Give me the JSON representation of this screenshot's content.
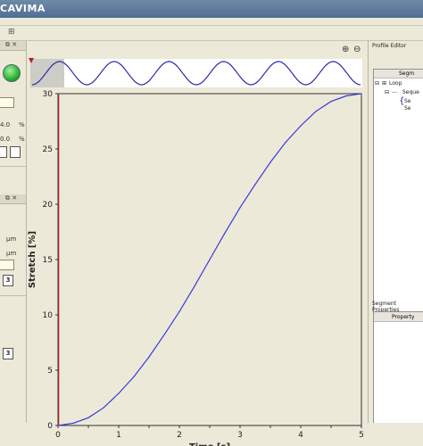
{
  "app": {
    "title": "CAVIMA"
  },
  "left_panel": {
    "close_glyph": "⧉ ✕",
    "values": {
      "v1": "4.0",
      "v1_unit": "%",
      "v2": "0.0",
      "v2_unit": "%"
    },
    "units": {
      "u1": "µm",
      "u2": "µm"
    },
    "count_buttons": [
      "3",
      "3"
    ],
    "status_color": "#18a51f"
  },
  "profile_editor": {
    "title": "Profile Editor",
    "tree_header": "Segm",
    "tree_items": {
      "loop": "Loop",
      "sequence": "Seque",
      "seg_a": "Se",
      "seg_b": "Se"
    }
  },
  "segment_properties": {
    "title": "Segment Properties",
    "header": "Property"
  },
  "chart_data": {
    "type": "line",
    "title": "",
    "xlabel": "Time [s]",
    "ylabel": "Stretch [%]",
    "xlim": [
      0,
      5
    ],
    "ylim": [
      0,
      30
    ],
    "xticks": [
      0,
      0.5,
      1,
      1.5,
      2,
      2.5,
      3,
      3.5,
      4,
      4.5,
      5
    ],
    "xtick_labels": [
      "0",
      "",
      "1",
      "",
      "2",
      "",
      "3",
      "",
      "4",
      "",
      "5"
    ],
    "yticks": [
      0,
      5,
      10,
      15,
      20,
      25,
      30
    ],
    "ytick_labels": [
      "0",
      "5",
      "10",
      "15",
      "20",
      "25",
      "30"
    ],
    "series": [
      {
        "color": "#3a3ad8",
        "x": [
          0,
          0.25,
          0.5,
          0.75,
          1,
          1.25,
          1.5,
          1.75,
          2,
          2.25,
          2.5,
          2.75,
          3,
          3.25,
          3.5,
          3.75,
          4,
          4.25,
          4.5,
          4.75,
          5
        ],
        "y": [
          0,
          0.2,
          0.7,
          1.6,
          2.9,
          4.4,
          6.2,
          8.2,
          10.3,
          12.6,
          15,
          17.4,
          19.7,
          21.8,
          23.8,
          25.6,
          27.1,
          28.4,
          29.3,
          29.8,
          30
        ]
      }
    ],
    "cursor": {
      "x": 0.01,
      "color": "#b02020"
    },
    "overview": {
      "type": "line",
      "cycles": 6,
      "color": "#2a2aa8",
      "background": "#ffffff",
      "selection_color": "#c8c6c0"
    },
    "grid": false,
    "plot_background": "#ece9d8"
  }
}
